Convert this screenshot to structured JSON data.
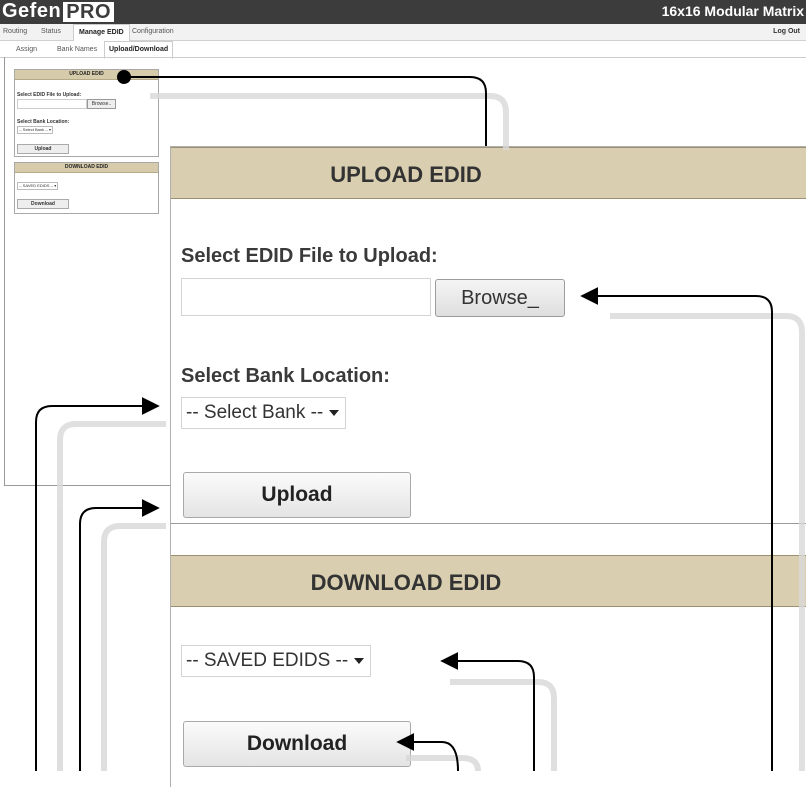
{
  "header": {
    "brand_gefen": "Gefen",
    "brand_pro": "PRO",
    "product": "16x16 Modular Matrix",
    "logout": "Log Out"
  },
  "nav": {
    "tabs": [
      "Routing",
      "Status",
      "Manage EDID",
      "Configuration"
    ],
    "active": "Manage EDID"
  },
  "subnav": {
    "tabs": [
      "Assign",
      "Bank Names",
      "Upload/Download"
    ],
    "active": "Upload/Download"
  },
  "upload": {
    "title": "UPLOAD EDID",
    "file_label": "Select EDID File to Upload:",
    "file_value": "",
    "browse_small": "Browse..",
    "browse": "Browse_",
    "bank_label": "Select Bank Location:",
    "bank_select": "-- Select Bank --",
    "upload_button": "Upload"
  },
  "download": {
    "title": "DOWNLOAD EDID",
    "saved_select": "-- SAVED EDIDS --",
    "download_button": "Download"
  },
  "colors": {
    "panel_header": "#d9cfb0",
    "topbar": "#3c3c3c",
    "callout_line": "#000000"
  }
}
